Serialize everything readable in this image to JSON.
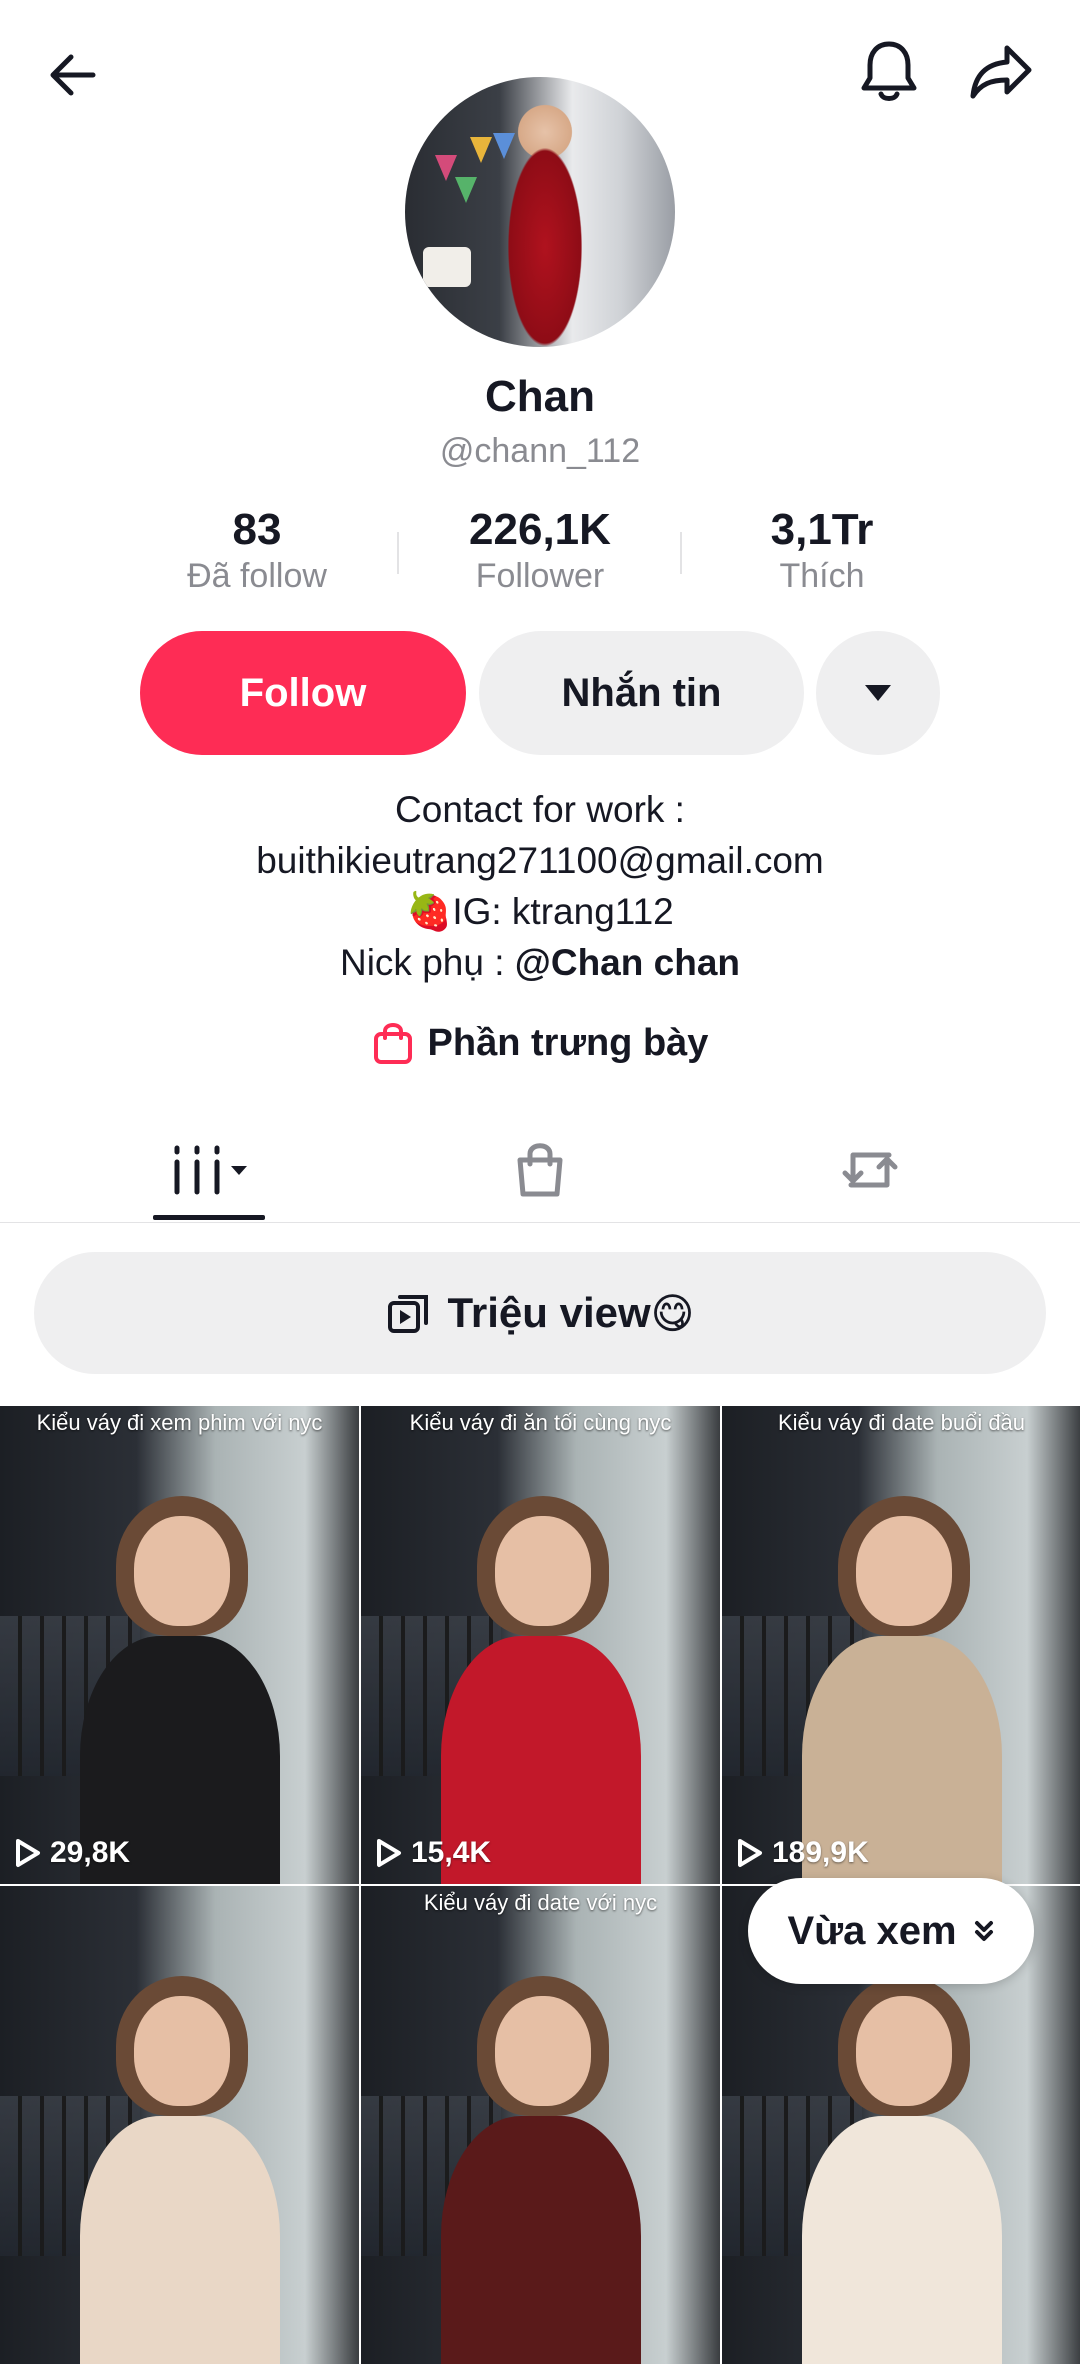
{
  "header": {
    "back_icon": "arrow-left-icon",
    "bell_icon": "bell-icon",
    "share_icon": "share-arrow-icon"
  },
  "profile": {
    "name": "Chan",
    "handle": "@chann_112",
    "stats": [
      {
        "value": "83",
        "label": "Đã follow"
      },
      {
        "value": "226,1K",
        "label": "Follower"
      },
      {
        "value": "3,1Tr",
        "label": "Thích"
      }
    ]
  },
  "actions": {
    "follow_label": "Follow",
    "message_label": "Nhắn tin",
    "more_icon": "caret-down-icon",
    "follow_color": "#fe2c55"
  },
  "bio": {
    "line1": "Contact for work :",
    "line2": "buithikieutrang271100@gmail.com",
    "line3_emoji": "🍓",
    "line3": "IG: ktrang112",
    "line4_prefix": "Nick phụ : ",
    "line4_mention": "@Chan chan"
  },
  "showcase": {
    "label": "Phần trưng bày",
    "icon": "shopping-bag-icon"
  },
  "tabs": [
    {
      "name": "videos",
      "icon": "grid-columns-icon",
      "active": true
    },
    {
      "name": "shop",
      "icon": "bag-icon",
      "active": false
    },
    {
      "name": "reposts",
      "icon": "repost-icon",
      "active": false
    }
  ],
  "playlist": {
    "label": "Triệu view",
    "emoji": "😋",
    "icon": "playlist-icon"
  },
  "videos": [
    {
      "caption": "Kiểu váy đi xem phim với nyc",
      "views": "29,8K",
      "dress": "#1b1b1d"
    },
    {
      "caption": "Kiểu váy đi ăn tối cùng nyc",
      "views": "15,4K",
      "dress": "#c2182a"
    },
    {
      "caption": "Kiểu váy đi date buổi đầu",
      "views": "189,9K",
      "dress": "#c9b196"
    },
    {
      "caption": "",
      "views": "",
      "dress": "#e9d7c6"
    },
    {
      "caption": "Kiểu váy đi date với nyc",
      "views": "",
      "dress": "#5a1a1a"
    },
    {
      "caption": "",
      "views": "",
      "dress": "#f0e6da"
    }
  ],
  "recent": {
    "label": "Vừa xem",
    "icon": "double-chevron-down-icon"
  }
}
